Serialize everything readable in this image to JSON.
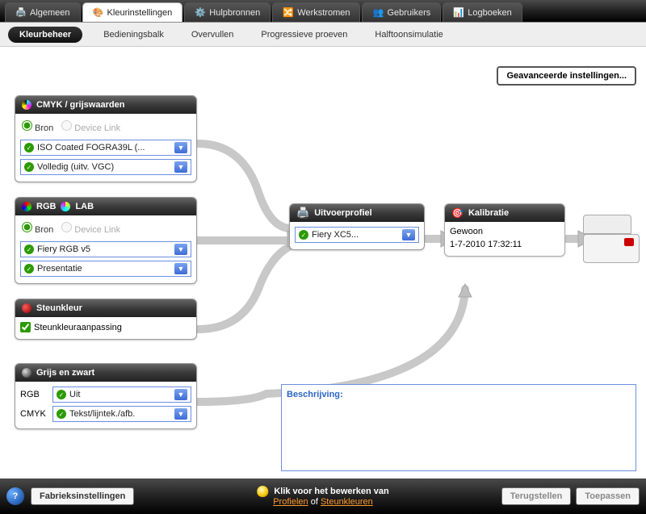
{
  "tabs": {
    "algemeen": "Algemeen",
    "kleurinstellingen": "Kleurinstellingen",
    "hulpbronnen": "Hulpbronnen",
    "werkstromen": "Werkstromen",
    "gebruikers": "Gebruikers",
    "logboeken": "Logboeken"
  },
  "subtabs": {
    "kleurbeheer": "Kleurbeheer",
    "bedieningsbalk": "Bedieningsbalk",
    "overvullen": "Overvullen",
    "progressieve": "Progressieve proeven",
    "halftoon": "Halftoonsimulatie"
  },
  "advanced_button": "Geavanceerde instellingen...",
  "cmyk": {
    "title": "CMYK / grijswaarden",
    "radio_bron": "Bron",
    "radio_dl": "Device Link",
    "select1": "ISO Coated FOGRA39L (...",
    "select2": "Volledig (uitv. VGC)"
  },
  "rgb": {
    "title_a": "RGB",
    "title_b": "LAB",
    "radio_bron": "Bron",
    "radio_dl": "Device Link",
    "select1": "Fiery RGB v5",
    "select2": "Presentatie"
  },
  "spot": {
    "title": "Steunkleur",
    "check": "Steunkleuraanpassing"
  },
  "gray": {
    "title": "Grijs en zwart",
    "row1_label": "RGB",
    "row1_value": "Uit",
    "row2_label": "CMYK",
    "row2_value": "Tekst/lijntek./afb."
  },
  "output": {
    "title": "Uitvoerprofiel",
    "select": "Fiery XC5..."
  },
  "calibration": {
    "title": "Kalibratie",
    "line1": "Gewoon",
    "line2": "1-7-2010 17:32:11"
  },
  "description_label": "Beschrijving:",
  "footer": {
    "factory": "Fabrieksinstellingen",
    "hint_pre": "Klik voor het bewerken van",
    "hint_link1": "Profielen",
    "hint_of": " of ",
    "hint_link2": "Steunkleuren",
    "reset": "Terugstellen",
    "apply": "Toepassen"
  }
}
